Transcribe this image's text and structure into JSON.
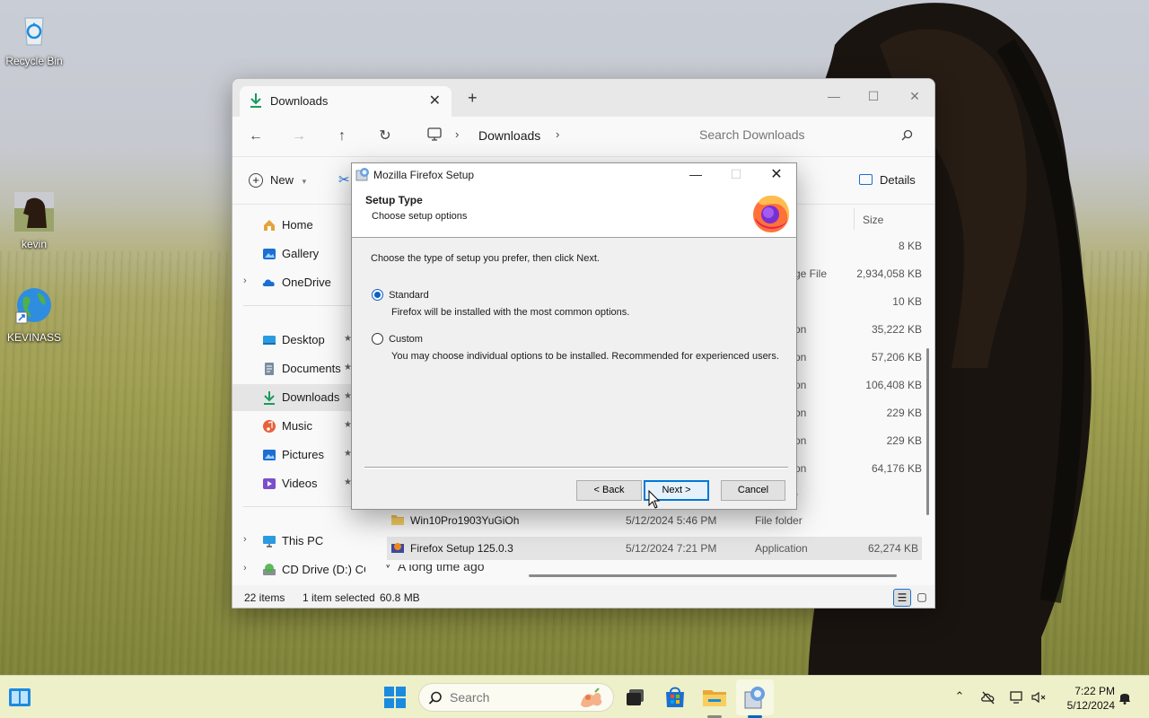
{
  "desktop": {
    "icons": [
      {
        "label": "Recycle Bin",
        "icon": "recycle-bin-icon"
      },
      {
        "label": "kevin",
        "icon": "horse-thumbnail-icon"
      },
      {
        "label": "KEVINASS",
        "icon": "globe-shortcut-icon"
      }
    ]
  },
  "explorer": {
    "tab_label": "Downloads",
    "breadcrumb": "Downloads",
    "search_placeholder": "Search Downloads",
    "cmd_new": "New",
    "cmd_details": "Details",
    "sidebar": [
      {
        "label": "Home",
        "icon": "home-icon"
      },
      {
        "label": "Gallery",
        "icon": "gallery-icon"
      },
      {
        "label": "OneDrive",
        "icon": "cloud-icon"
      },
      {
        "label": "Desktop",
        "icon": "desktop-folder-icon"
      },
      {
        "label": "Documents",
        "icon": "documents-icon"
      },
      {
        "label": "Downloads",
        "icon": "download-icon"
      },
      {
        "label": "Music",
        "icon": "music-icon"
      },
      {
        "label": "Pictures",
        "icon": "pictures-icon"
      },
      {
        "label": "Videos",
        "icon": "videos-icon"
      },
      {
        "label": "This PC",
        "icon": "this-pc-icon"
      },
      {
        "label": "CD Drive (D:) CC",
        "icon": "cd-drive-icon"
      }
    ],
    "columns": {
      "size": "Size"
    },
    "partial_rows": [
      {
        "type": "",
        "size": "8 KB"
      },
      {
        "type": "ge File",
        "size": "2,934,058 KB"
      },
      {
        "type": "",
        "size": "10 KB"
      },
      {
        "type": "on",
        "size": "35,222 KB"
      },
      {
        "type": "on",
        "size": "57,206 KB"
      },
      {
        "type": "on",
        "size": "106,408 KB"
      },
      {
        "type": "on",
        "size": "229 KB"
      },
      {
        "type": "on",
        "size": "229 KB"
      },
      {
        "type": "on",
        "size": "64,176 KB"
      },
      {
        "type": "r",
        "size": ""
      }
    ],
    "rows": [
      {
        "name": "Win10Pro1903YuGiOh",
        "date": "5/12/2024 5:46 PM",
        "type": "File folder",
        "size": ""
      },
      {
        "name": "Firefox Setup 125.0.3",
        "date": "5/12/2024 7:21 PM",
        "type": "Application",
        "size": "62,274 KB"
      }
    ],
    "group_header_fragment": "A long time ago",
    "status": {
      "items": "22 items",
      "selected": "1 item selected",
      "size": "60.8 MB"
    }
  },
  "dialog": {
    "title": "Mozilla Firefox Setup",
    "header_title": "Setup Type",
    "header_subtitle": "Choose setup options",
    "intro": "Choose the type of setup you prefer, then click Next.",
    "options": [
      {
        "label": "Standard",
        "description": "Firefox will be installed with the most common options.",
        "checked": true
      },
      {
        "label": "Custom",
        "description": "You may choose individual options to be installed. Recommended for experienced users.",
        "checked": false
      }
    ],
    "buttons": {
      "back": "< Back",
      "next": "Next >",
      "cancel": "Cancel"
    }
  },
  "taskbar": {
    "search_placeholder": "Search",
    "time": "7:22 PM",
    "date": "5/12/2024"
  },
  "colors": {
    "accent": "#0067c0",
    "taskbar_bg": "#eef0c9",
    "dialog_bg": "#f0f0f0"
  }
}
